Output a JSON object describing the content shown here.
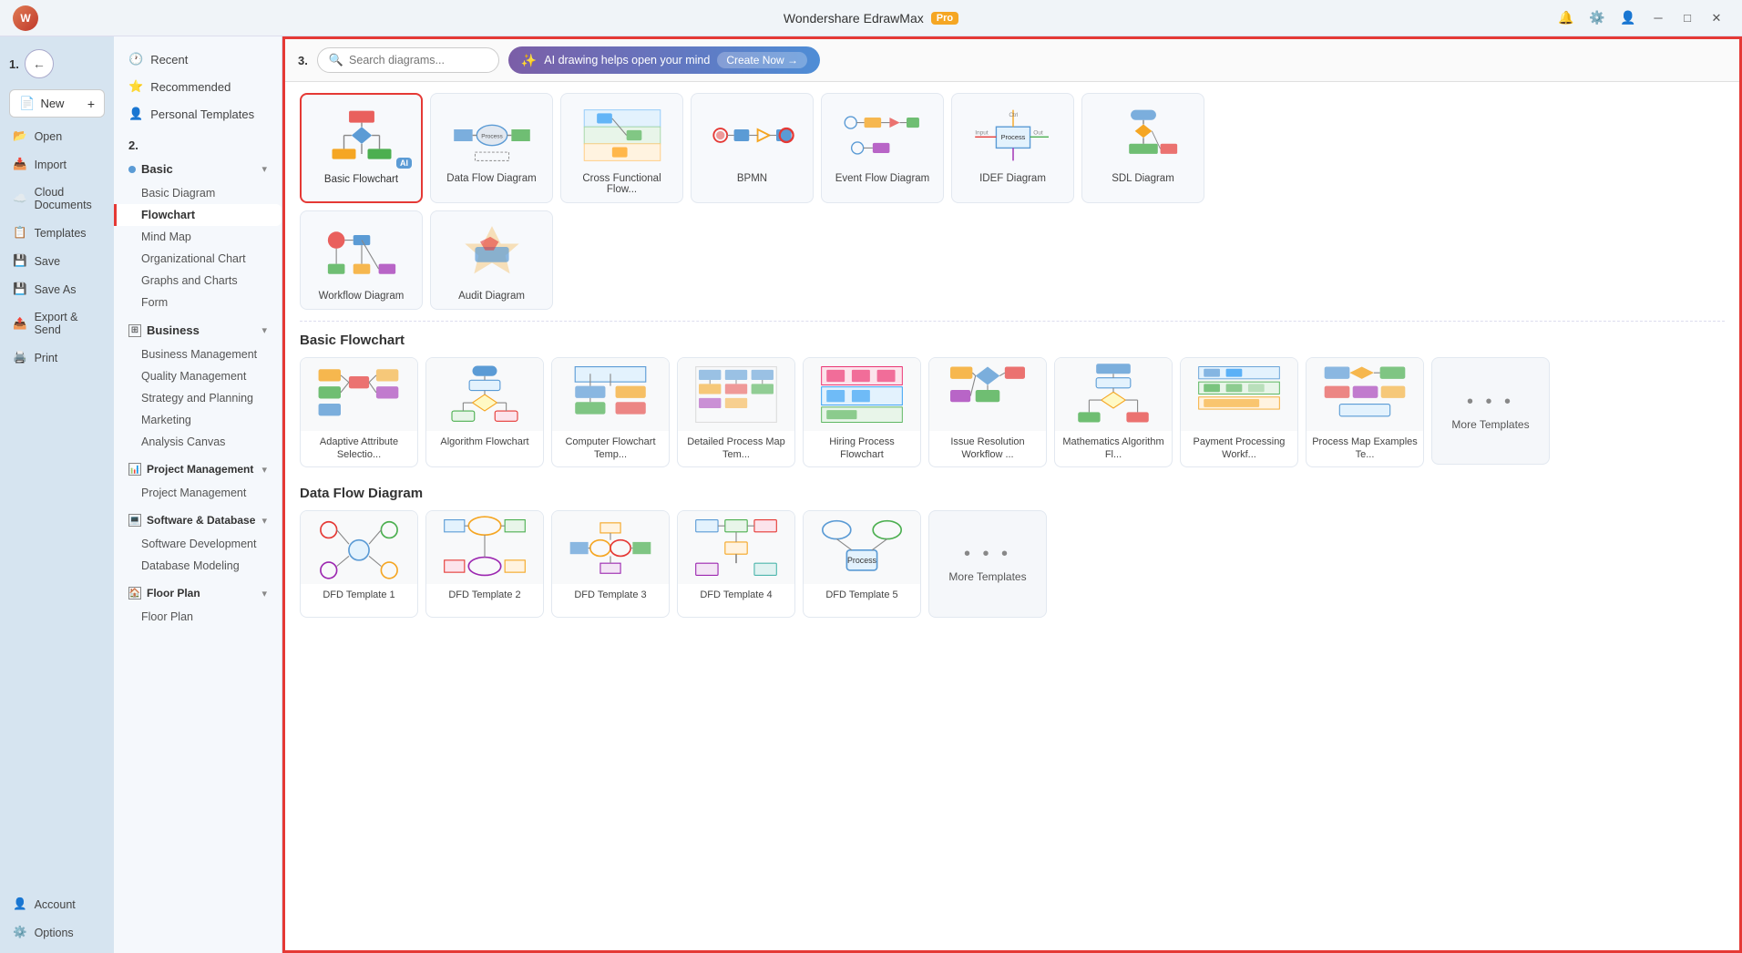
{
  "app": {
    "title": "Wondershare EdrawMax",
    "pro_badge": "Pro"
  },
  "sidebar": {
    "step1_label": "1.",
    "back_btn_label": "←",
    "new_btn_label": "New",
    "items": [
      {
        "id": "open",
        "label": "Open",
        "icon": "📂"
      },
      {
        "id": "import",
        "label": "Import",
        "icon": "📥"
      },
      {
        "id": "cloud",
        "label": "Cloud Documents",
        "icon": "☁️"
      },
      {
        "id": "templates",
        "label": "Templates",
        "icon": "📋"
      },
      {
        "id": "save",
        "label": "Save",
        "icon": "💾"
      },
      {
        "id": "save-as",
        "label": "Save As",
        "icon": "💾"
      },
      {
        "id": "export",
        "label": "Export & Send",
        "icon": "📤"
      },
      {
        "id": "print",
        "label": "Print",
        "icon": "🖨️"
      }
    ],
    "bottom_items": [
      {
        "id": "account",
        "label": "Account",
        "icon": "👤"
      },
      {
        "id": "options",
        "label": "Options",
        "icon": "⚙️"
      }
    ]
  },
  "nav": {
    "step2_label": "2.",
    "sections": [
      {
        "id": "recent",
        "label": "Recent",
        "icon": "🕐",
        "type": "header"
      },
      {
        "id": "recommended",
        "label": "Recommended",
        "icon": "⭐",
        "type": "header"
      },
      {
        "id": "personal",
        "label": "Personal Templates",
        "icon": "👤",
        "type": "header"
      },
      {
        "id": "basic",
        "label": "Basic",
        "type": "section",
        "children": [
          {
            "id": "basic-diagram",
            "label": "Basic Diagram"
          },
          {
            "id": "flowchart",
            "label": "Flowchart",
            "active": true
          },
          {
            "id": "mind-map",
            "label": "Mind Map"
          },
          {
            "id": "org-chart",
            "label": "Organizational Chart"
          },
          {
            "id": "graphs",
            "label": "Graphs and Charts"
          },
          {
            "id": "form",
            "label": "Form"
          }
        ]
      },
      {
        "id": "business",
        "label": "Business",
        "type": "section",
        "children": [
          {
            "id": "biz-mgmt",
            "label": "Business Management"
          },
          {
            "id": "quality",
            "label": "Quality Management"
          },
          {
            "id": "strategy",
            "label": "Strategy and Planning"
          },
          {
            "id": "marketing",
            "label": "Marketing"
          },
          {
            "id": "analysis",
            "label": "Analysis Canvas"
          }
        ]
      },
      {
        "id": "project",
        "label": "Project Management",
        "type": "section",
        "children": [
          {
            "id": "proj-mgmt",
            "label": "Project Management"
          }
        ]
      },
      {
        "id": "software",
        "label": "Software & Database",
        "type": "section",
        "children": [
          {
            "id": "sw-dev",
            "label": "Software Development"
          },
          {
            "id": "db-model",
            "label": "Database Modeling"
          }
        ]
      },
      {
        "id": "floor",
        "label": "Floor Plan",
        "type": "section",
        "children": [
          {
            "id": "floor-plan",
            "label": "Floor Plan"
          }
        ]
      }
    ]
  },
  "topbar": {
    "step3_label": "3.",
    "search_placeholder": "Search diagrams...",
    "ai_text": "AI drawing helps open your mind",
    "create_now": "Create Now →"
  },
  "diagram_types": [
    {
      "id": "basic-flowchart",
      "label": "Basic Flowchart",
      "selected": true,
      "has_ai": true
    },
    {
      "id": "data-flow",
      "label": "Data Flow Diagram",
      "selected": false
    },
    {
      "id": "cross-functional",
      "label": "Cross Functional Flow...",
      "selected": false
    },
    {
      "id": "bpmn",
      "label": "BPMN",
      "selected": false
    },
    {
      "id": "event-flow",
      "label": "Event Flow Diagram",
      "selected": false
    },
    {
      "id": "idef",
      "label": "IDEF Diagram",
      "selected": false
    },
    {
      "id": "sdl",
      "label": "SDL Diagram",
      "selected": false
    },
    {
      "id": "workflow",
      "label": "Workflow Diagram",
      "selected": false
    },
    {
      "id": "audit",
      "label": "Audit Diagram",
      "selected": false
    }
  ],
  "basic_flowchart": {
    "section_title": "Basic Flowchart",
    "templates": [
      {
        "id": "adaptive",
        "label": "Adaptive Attribute Selectio..."
      },
      {
        "id": "algorithm",
        "label": "Algorithm Flowchart"
      },
      {
        "id": "computer",
        "label": "Computer Flowchart Temp..."
      },
      {
        "id": "detailed",
        "label": "Detailed Process Map Tem..."
      },
      {
        "id": "hiring",
        "label": "Hiring Process Flowchart"
      },
      {
        "id": "issue",
        "label": "Issue Resolution Workflow ..."
      },
      {
        "id": "math",
        "label": "Mathematics Algorithm Fl..."
      },
      {
        "id": "payment",
        "label": "Payment Processing Workf..."
      },
      {
        "id": "process-map",
        "label": "Process Map Examples Te..."
      },
      {
        "id": "more1",
        "label": "More Templates",
        "is_more": true
      }
    ]
  },
  "data_flow": {
    "section_title": "Data Flow Diagram",
    "templates": [
      {
        "id": "df1",
        "label": "Template 1"
      },
      {
        "id": "df2",
        "label": "Template 2"
      },
      {
        "id": "df3",
        "label": "Template 3"
      },
      {
        "id": "df4",
        "label": "Template 4"
      },
      {
        "id": "df5",
        "label": "Template 5"
      },
      {
        "id": "more2",
        "label": "More Templates",
        "is_more": true
      }
    ]
  },
  "colors": {
    "accent_red": "#e53935",
    "accent_blue": "#5b9bd5",
    "bg_light": "#f0f4f8"
  }
}
